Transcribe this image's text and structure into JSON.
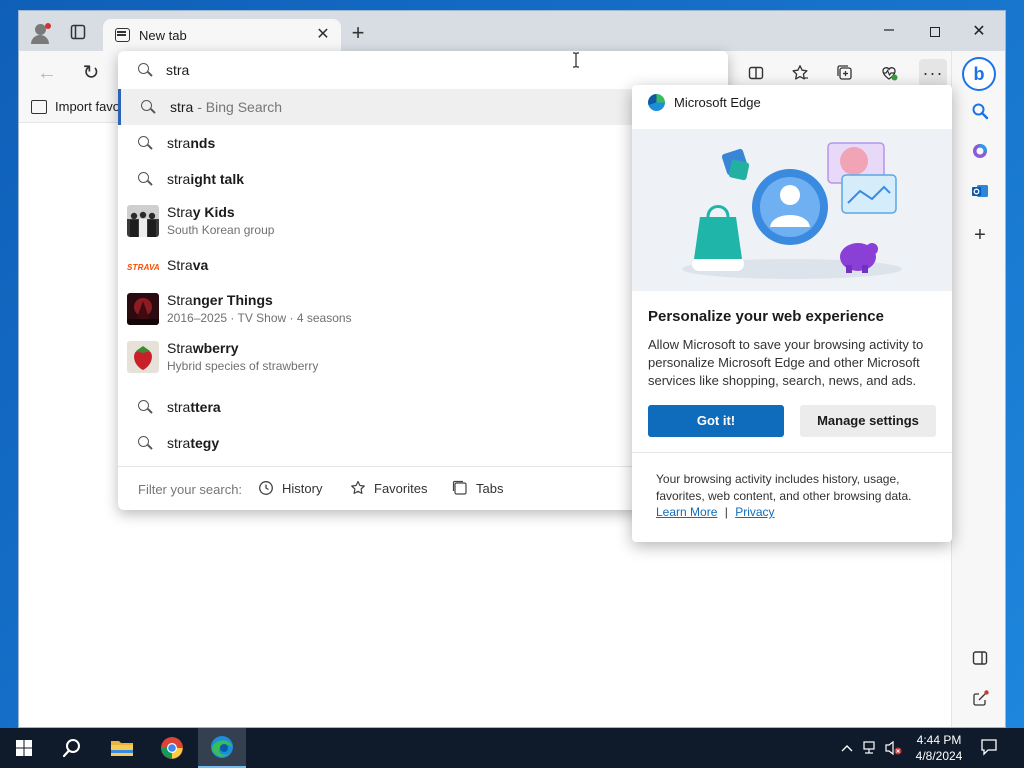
{
  "window": {
    "tab_title": "New tab",
    "tab_close": "✕",
    "new_tab": "+",
    "min": "—",
    "close": "✕"
  },
  "toolbar": {
    "back": "←",
    "refresh": "↻",
    "more": "···"
  },
  "bookmarks": {
    "import_label": "Import favo"
  },
  "omnibox": {
    "query": "stra",
    "suggestions": [
      {
        "prefix": "stra",
        "rest": "",
        "sub": " - Bing Search",
        "kind": "search",
        "selected": true
      },
      {
        "prefix": "stra",
        "rest": "nds",
        "kind": "search"
      },
      {
        "prefix": "stra",
        "rest": "ight talk",
        "kind": "search"
      },
      {
        "prefix": "Stra",
        "rest": "y Kids",
        "desc": "South Korean group",
        "kind": "entity"
      },
      {
        "prefix": "Stra",
        "rest": "va",
        "kind": "brand",
        "logo_text": "STRAVA"
      },
      {
        "prefix": "Stra",
        "rest": "nger Things",
        "desc": "2016–2025 · TV Show · 4 seasons",
        "kind": "entity"
      },
      {
        "prefix": "Stra",
        "rest": "wberry",
        "desc": "Hybrid species of strawberry",
        "kind": "entity"
      },
      {
        "prefix": "stra",
        "rest": "ttera",
        "kind": "search"
      },
      {
        "prefix": "stra",
        "rest": "tegy",
        "kind": "search"
      }
    ],
    "filter_label": "Filter your search:",
    "filters": {
      "history": "History",
      "favorites": "Favorites",
      "tabs": "Tabs"
    }
  },
  "popup": {
    "header": "Microsoft Edge",
    "title": "Personalize your web experience",
    "body": "Allow Microsoft to save your browsing activity to personalize Microsoft Edge and other Microsoft services like shopping, search, news, and ads.",
    "primary_button": "Got it!",
    "secondary_button": "Manage settings",
    "footer": "Your browsing activity includes history, usage, favorites, web content, and other browsing data.",
    "learn_more": "Learn More",
    "separator": "|",
    "privacy": "Privacy"
  },
  "sidebar": {
    "bing_label": "b",
    "add": "+"
  },
  "taskbar": {
    "time": "4:44 PM",
    "date": "4/8/2024"
  },
  "colors": {
    "accent": "#0f6cbd",
    "selection_bar": "#2b63b8",
    "strava": "#fc4c02"
  }
}
